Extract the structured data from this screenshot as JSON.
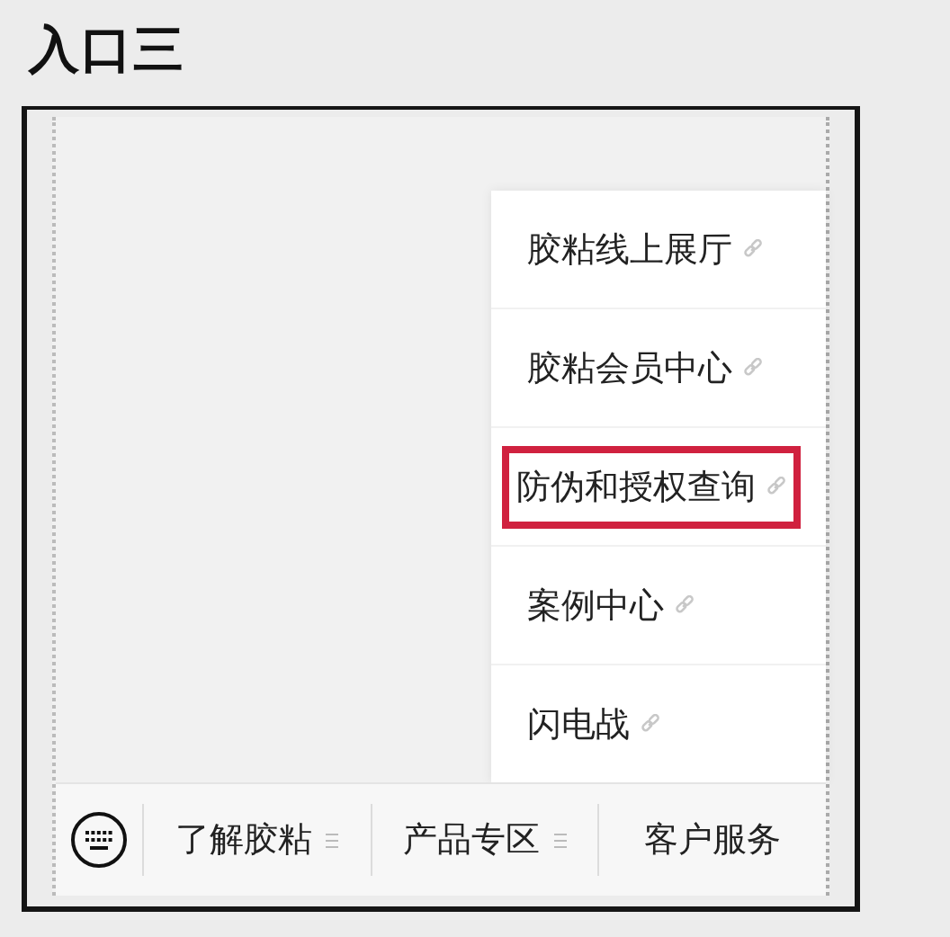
{
  "heading": "入口三",
  "popup_menu": [
    {
      "label": "胶粘线上展厅",
      "highlighted": false
    },
    {
      "label": "胶粘会员中心",
      "highlighted": false
    },
    {
      "label": "防伪和授权查询",
      "highlighted": true
    },
    {
      "label": "案例中心",
      "highlighted": false
    },
    {
      "label": "闪电战",
      "highlighted": false
    }
  ],
  "bottom_menu": [
    {
      "label": "了解胶粘",
      "menu_icon": true
    },
    {
      "label": "产品专区",
      "menu_icon": true
    },
    {
      "label": "客户服务",
      "menu_icon": false
    }
  ]
}
